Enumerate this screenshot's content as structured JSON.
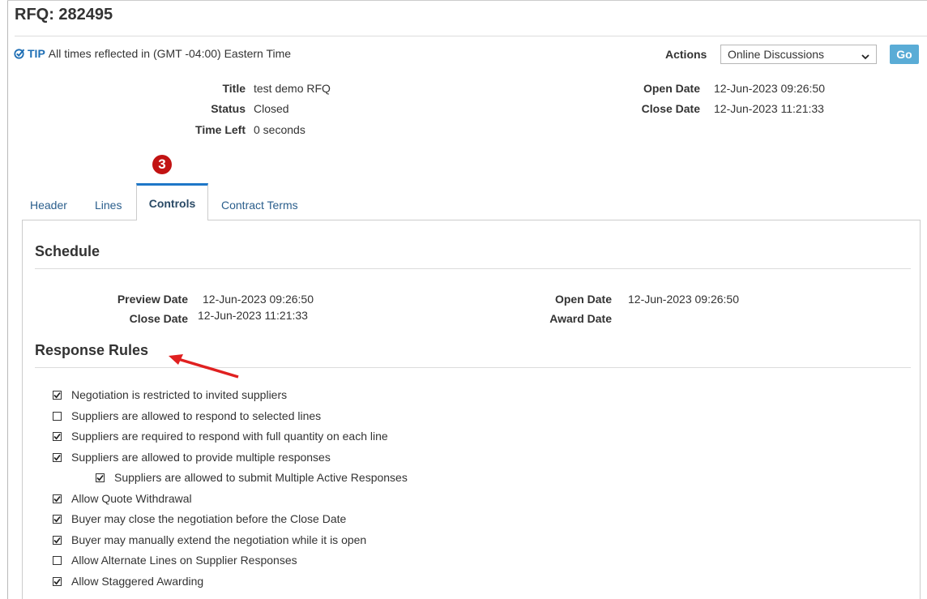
{
  "page_title": "RFQ: 282495",
  "tip": {
    "label": "TIP",
    "text": "All times reflected in (GMT -04:00) Eastern Time"
  },
  "actions": {
    "label": "Actions",
    "selected": "Online Discussions",
    "go_label": "Go"
  },
  "summary": {
    "title_label": "Title",
    "title_value": "test demo RFQ",
    "status_label": "Status",
    "status_value": "Closed",
    "time_left_label": "Time Left",
    "time_left_value": "0 seconds",
    "open_date_label": "Open Date",
    "open_date_value": "12-Jun-2023 09:26:50",
    "close_date_label": "Close Date",
    "close_date_value": "12-Jun-2023 11:21:33"
  },
  "callout_badge": "3",
  "tabs": [
    {
      "label": "Header",
      "active": false
    },
    {
      "label": "Lines",
      "active": false
    },
    {
      "label": "Controls",
      "active": true
    },
    {
      "label": "Contract Terms",
      "active": false
    }
  ],
  "schedule": {
    "heading": "Schedule",
    "preview_date_label": "Preview Date",
    "preview_date_value": "12-Jun-2023 09:26:50",
    "close_date_label": "Close Date",
    "close_date_value": "12-Jun-2023 11:21:33",
    "open_date_label": "Open Date",
    "open_date_value": "12-Jun-2023 09:26:50",
    "award_date_label": "Award Date",
    "award_date_value": ""
  },
  "response_rules": {
    "heading": "Response Rules",
    "items": [
      {
        "label": "Negotiation is restricted to invited suppliers",
        "checked": true
      },
      {
        "label": "Suppliers are allowed to respond to selected lines",
        "checked": false
      },
      {
        "label": "Suppliers are required to respond with full quantity on each line",
        "checked": true
      },
      {
        "label": "Suppliers are allowed to provide multiple responses",
        "checked": true
      },
      {
        "label": "Suppliers are allowed to submit Multiple Active Responses",
        "checked": true
      },
      {
        "label": "Allow Quote Withdrawal",
        "checked": true
      },
      {
        "label": "Buyer may close the negotiation before the Close Date",
        "checked": true
      },
      {
        "label": "Buyer may manually extend the negotiation while it is open",
        "checked": true
      },
      {
        "label": "Allow Alternate Lines on Supplier Responses",
        "checked": false
      },
      {
        "label": "Allow Staggered Awarding",
        "checked": true
      }
    ]
  },
  "colors": {
    "accent_blue": "#1e77c8",
    "link_blue": "#2a5e8c",
    "go_button": "#5aacd6",
    "badge_red": "#c21313",
    "arrow_red": "#e02020"
  }
}
